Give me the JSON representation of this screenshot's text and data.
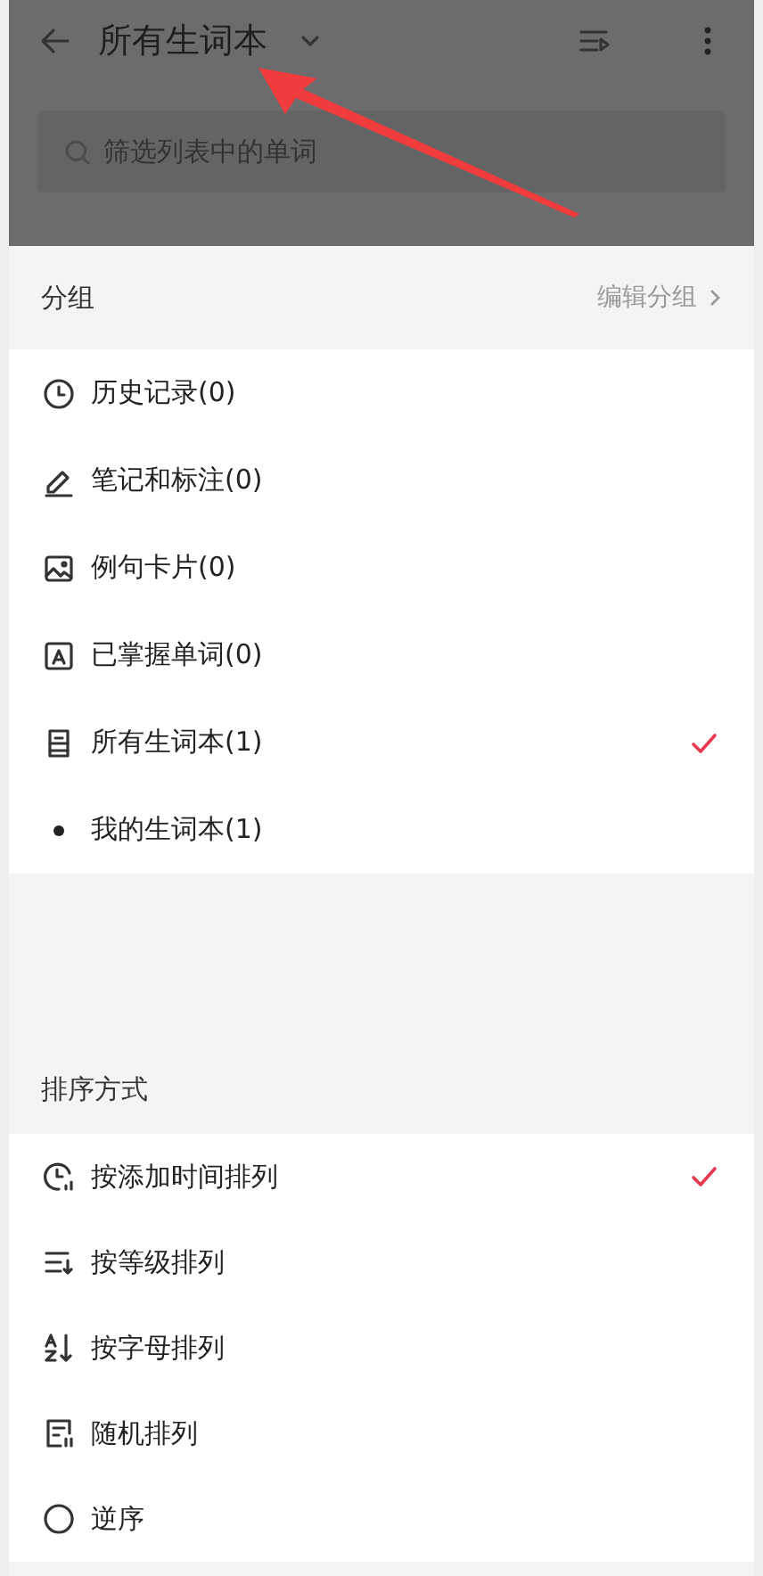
{
  "top_bar": {
    "title": "所有生词本",
    "search": {
      "placeholder": "筛选列表中的单词"
    }
  },
  "groups": {
    "title": "分组",
    "edit_link": "编辑分组",
    "items": [
      {
        "kind": "history",
        "label": "历史记录(0)",
        "selected": false
      },
      {
        "kind": "notes",
        "label": "笔记和标注(0)",
        "selected": false
      },
      {
        "kind": "cards",
        "label": "例句卡片(0)",
        "selected": false
      },
      {
        "kind": "mastered",
        "label": "已掌握单词(0)",
        "selected": false
      },
      {
        "kind": "all",
        "label": "所有生词本(1)",
        "selected": true
      },
      {
        "kind": "notebook",
        "label": "我的生词本(1)",
        "selected": false
      }
    ]
  },
  "sort": {
    "title": "排序方式",
    "items": [
      {
        "kind": "added",
        "label": "按添加时间排列",
        "selected": true
      },
      {
        "kind": "level",
        "label": "按等级排列",
        "selected": false
      },
      {
        "kind": "alpha",
        "label": "按字母排列",
        "selected": false
      },
      {
        "kind": "random",
        "label": "随机排列",
        "selected": false
      },
      {
        "kind": "reverse",
        "label": "逆序",
        "selected": false
      }
    ]
  }
}
